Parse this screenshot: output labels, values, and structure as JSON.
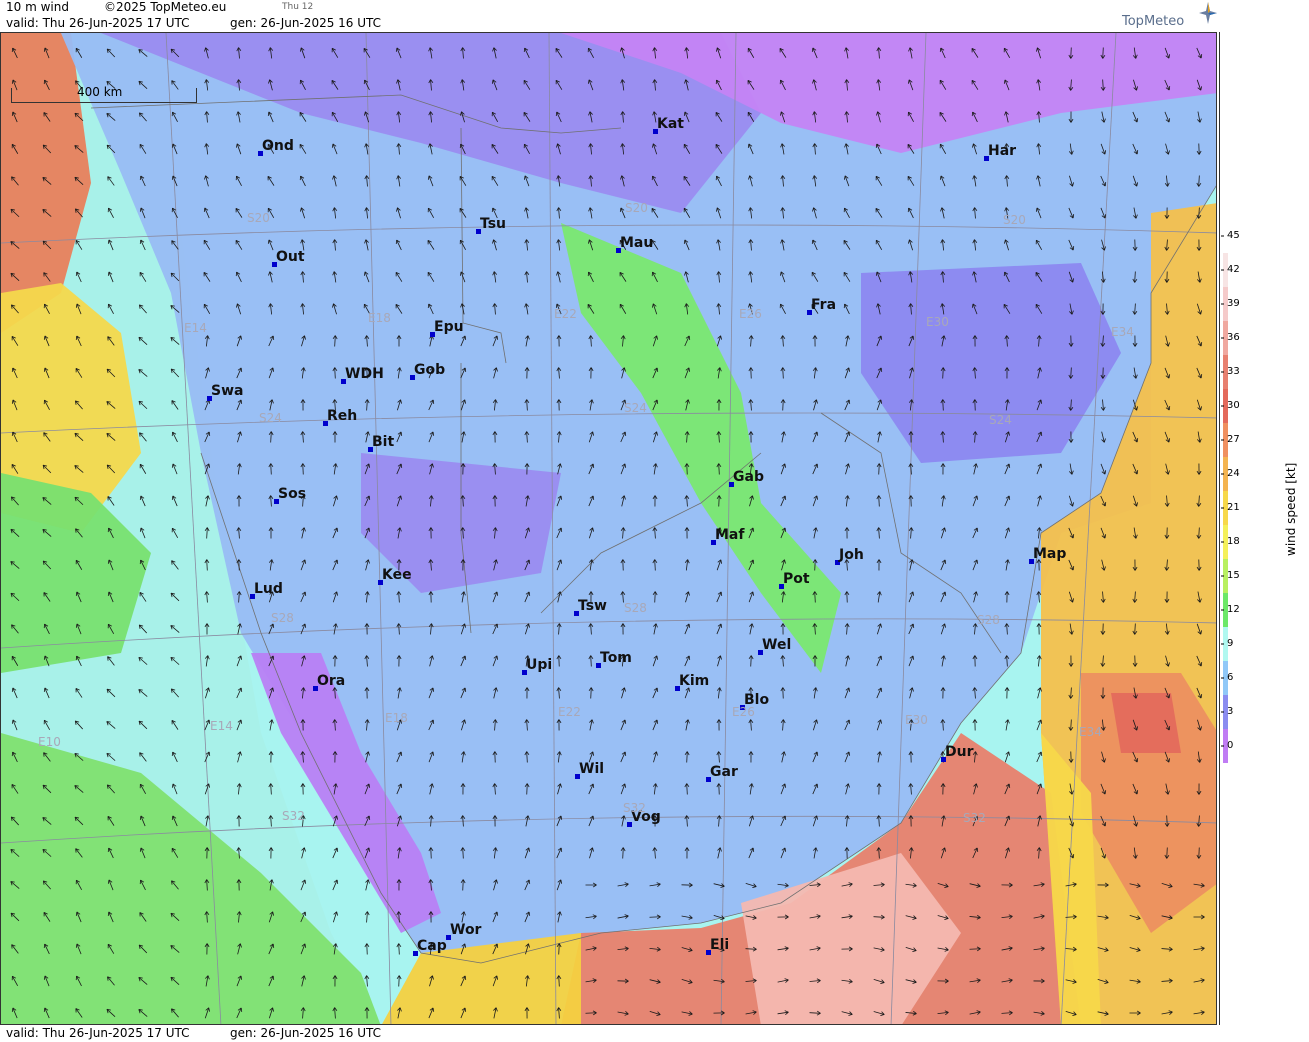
{
  "header": {
    "product": "10 m wind",
    "copyright": "©2025 TopMeteo.eu",
    "step": "Thu 12",
    "valid": "valid:  Thu  26-Jun-2025  17 UTC",
    "generated": "gen:  26-Jun-2025 16 UTC"
  },
  "footer": {
    "valid": "valid:  Thu  26-Jun-2025  17 UTC",
    "generated": "gen:  26-Jun-2025 16 UTC"
  },
  "logo": {
    "text": "TopMeteo"
  },
  "scale": {
    "label": "400 km"
  },
  "legend": {
    "title": "wind speed  [kt]",
    "ticks": [
      "45",
      "42",
      "39",
      "36",
      "33",
      "30",
      "27",
      "24",
      "21",
      "18",
      "15",
      "12",
      "9",
      "6",
      "3",
      "0"
    ],
    "colors": [
      "#ffffff",
      "#f7e4e4",
      "#f5caca",
      "#f0a8a0",
      "#e88070",
      "#e46a5c",
      "#f09060",
      "#f4b450",
      "#f7d84a",
      "#f4f05a",
      "#b8f060",
      "#6ce868",
      "#b0f8f0",
      "#90c8f8",
      "#8a8cf0",
      "#c07cf4"
    ]
  },
  "cities": [
    {
      "name": "Ond"
    },
    {
      "name": "Kat"
    },
    {
      "name": "Har"
    },
    {
      "name": "Tsu"
    },
    {
      "name": "Out"
    },
    {
      "name": "Mau"
    },
    {
      "name": "Fra"
    },
    {
      "name": "Epu"
    },
    {
      "name": "WDH"
    },
    {
      "name": "Gob"
    },
    {
      "name": "Swa"
    },
    {
      "name": "Reh"
    },
    {
      "name": "Bit"
    },
    {
      "name": "Gab"
    },
    {
      "name": "Sos"
    },
    {
      "name": "Maf"
    },
    {
      "name": "Joh"
    },
    {
      "name": "Map"
    },
    {
      "name": "Kee"
    },
    {
      "name": "Pot"
    },
    {
      "name": "Lud"
    },
    {
      "name": "Tsw"
    },
    {
      "name": "Wel"
    },
    {
      "name": "Upi"
    },
    {
      "name": "Tom"
    },
    {
      "name": "Kim"
    },
    {
      "name": "Ora"
    },
    {
      "name": "Blo"
    },
    {
      "name": "Dur"
    },
    {
      "name": "Wil"
    },
    {
      "name": "Gar"
    },
    {
      "name": "Vog"
    },
    {
      "name": "Wor"
    },
    {
      "name": "Cap"
    },
    {
      "name": "Eli"
    }
  ],
  "grid_labels": [
    "S20",
    "S20",
    "S20",
    "E14",
    "E18",
    "E22",
    "E26",
    "E30",
    "E34",
    "S24",
    "S24",
    "S24",
    "S28",
    "S28",
    "S28",
    "E10",
    "E14",
    "E18",
    "E22",
    "E26",
    "E30",
    "E34",
    "S32",
    "S32",
    "S32"
  ]
}
